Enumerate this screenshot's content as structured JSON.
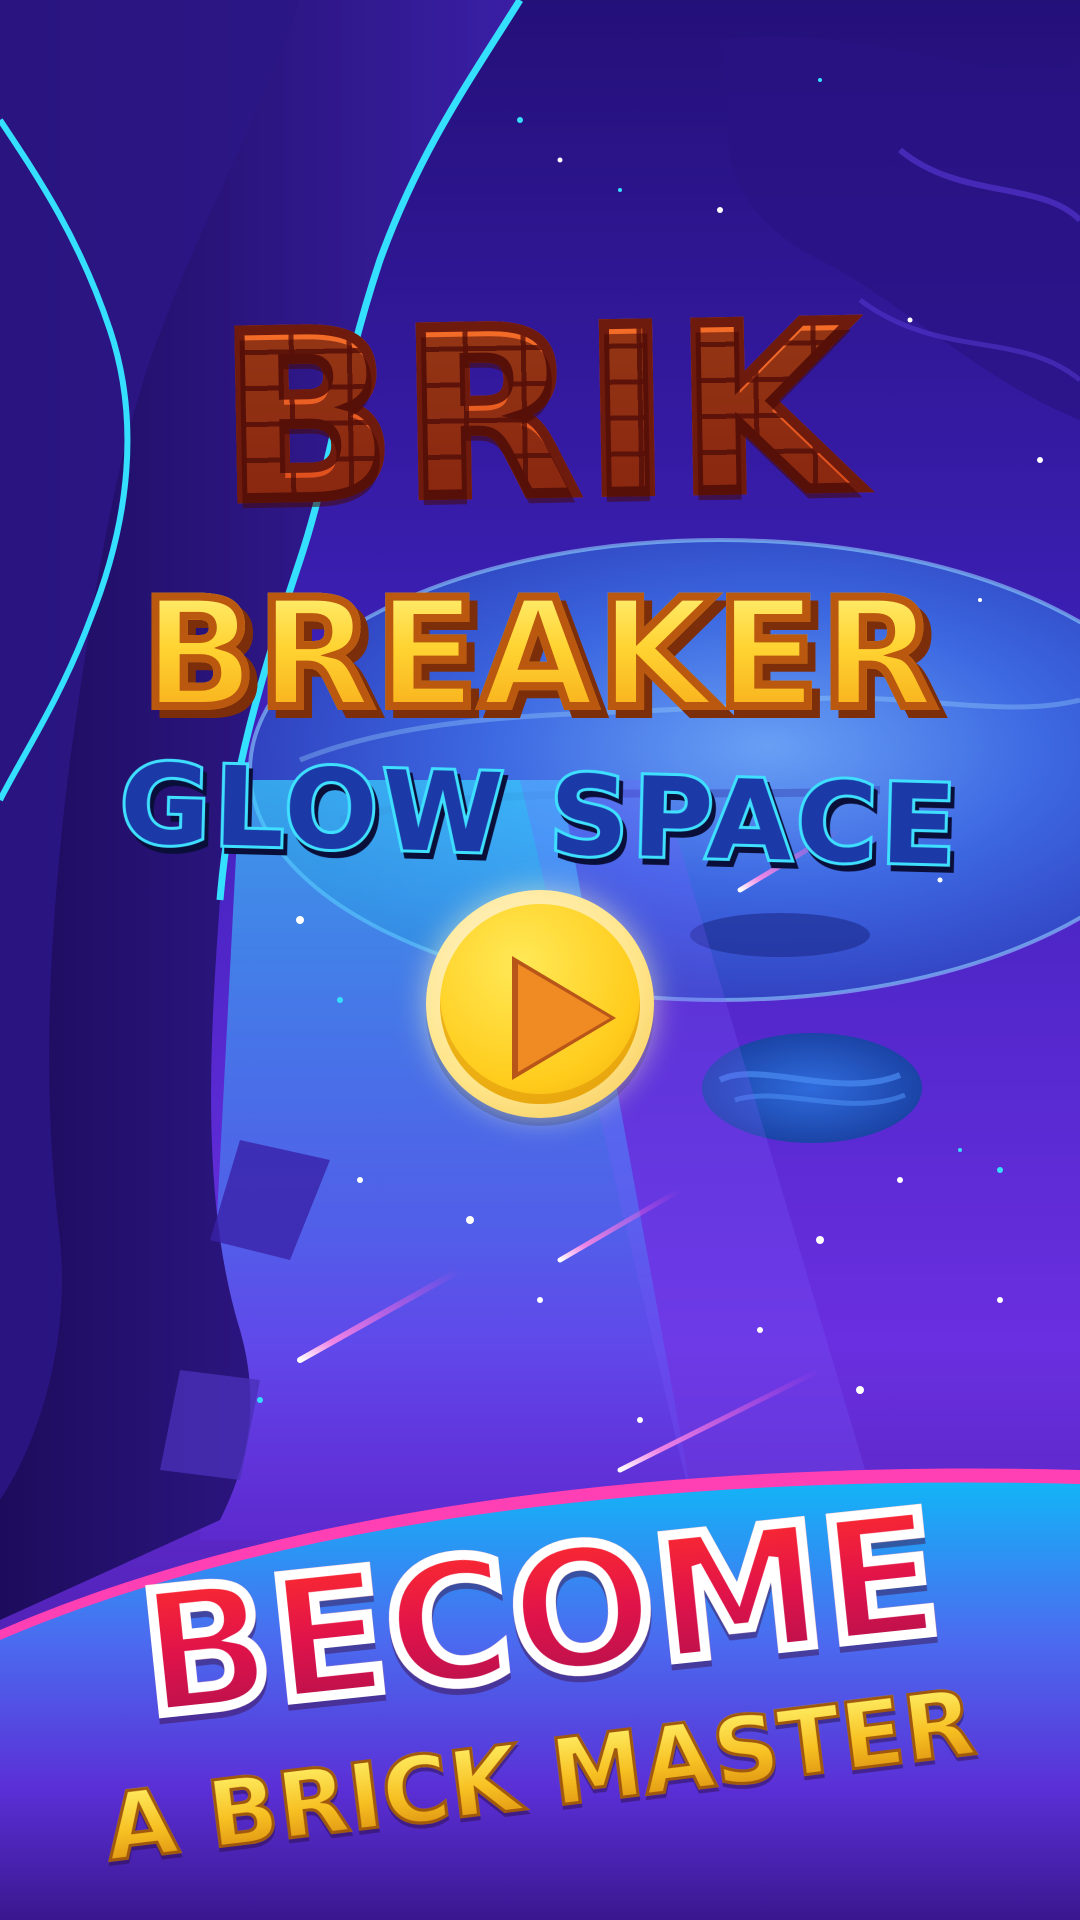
{
  "logo": {
    "line1": "BRIK",
    "line2": "BREAKER",
    "line3": "GLOW SPACE"
  },
  "play_button": {
    "icon": "play-icon"
  },
  "tagline": {
    "line1": "BECOME",
    "line2": "A BRICK MASTER"
  },
  "colors": {
    "sky": "#3a1ca8",
    "glow": "#31c9ff",
    "banner_top": "#13a8f5",
    "banner_bottom": "#5a1fd0",
    "brick": "#e8531e",
    "gold": "#ffd332",
    "accent_red": "#e0134a"
  }
}
